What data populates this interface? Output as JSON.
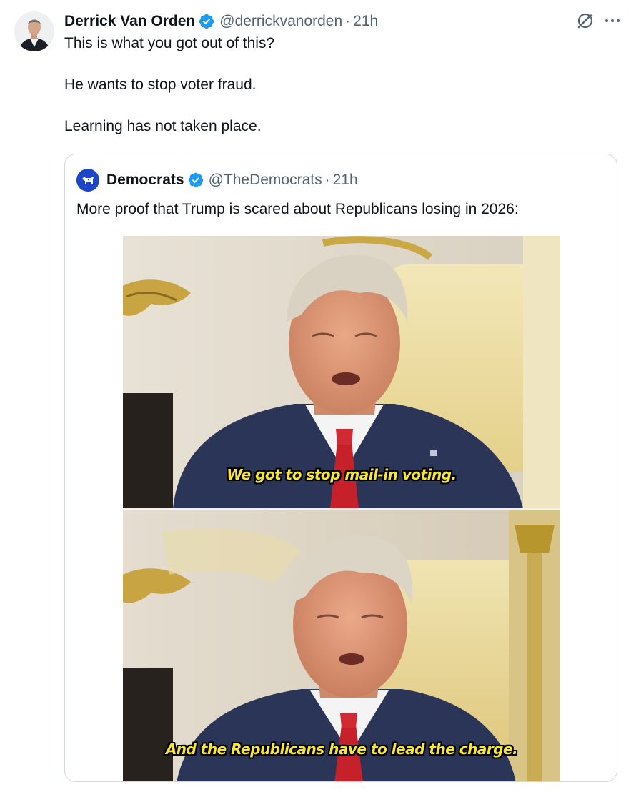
{
  "tweet": {
    "author": {
      "name": "Derrick Van Orden",
      "handle": "@derrickvanorden",
      "verified": true
    },
    "separator": "·",
    "time": "21h",
    "lines": [
      "This is what you got out of this?",
      "He wants to stop voter fraud.",
      "Learning has not taken place."
    ],
    "actions": {
      "grok_icon": "grok-icon",
      "more_icon": "more-icon",
      "more_label": "···"
    }
  },
  "quote": {
    "author": {
      "name": "Democrats",
      "handle": "@TheDemocrats",
      "verified": true,
      "avatar_icon": "donkey-icon"
    },
    "separator": "·",
    "time": "21h",
    "text": "More proof that Trump is scared about Republicans losing in 2026:",
    "media": {
      "captions": [
        "We got to stop mail-in voting.",
        "And the Republicans have to lead the charge."
      ]
    }
  },
  "colors": {
    "verified_blue": "#1d9bf0",
    "secondary_text": "#536471",
    "primary_text": "#0f1419",
    "card_border": "#cfd9de",
    "democrats_blue": "#1b46c9",
    "caption_yellow": "#f7e63a"
  }
}
